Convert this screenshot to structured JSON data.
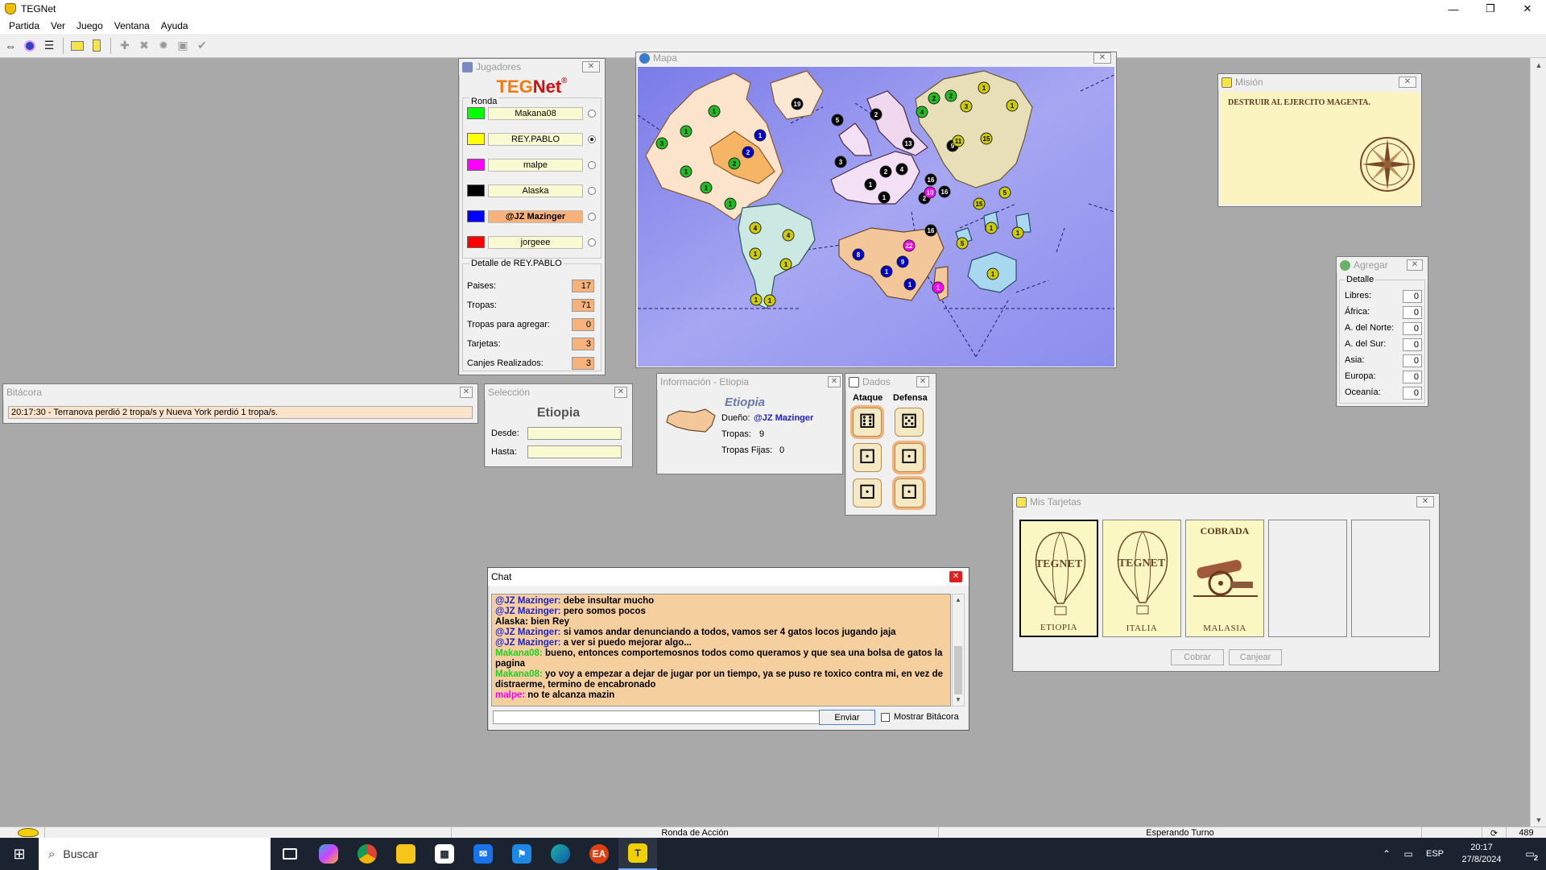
{
  "window": {
    "title": "TEGNet",
    "min": "—",
    "max": "❐",
    "close": "✕"
  },
  "menu": [
    "Partida",
    "Ver",
    "Juego",
    "Ventana",
    "Ayuda"
  ],
  "toolbar_icons": [
    "connect-icon",
    "server-icon",
    "list-icon",
    "card-yellow-icon",
    "card-icon",
    "add-army-icon",
    "delete-icon",
    "attack-icon",
    "regroup-icon",
    "check-icon"
  ],
  "jugadores": {
    "title": "Jugadores",
    "logo_teg": "TEG",
    "logo_net": "Net",
    "logo_reg": "®",
    "ronda_label": "Ronda",
    "players": [
      {
        "name": "Makana08",
        "color": "#00ff00",
        "current": false,
        "turn": false
      },
      {
        "name": "REY.PABLO",
        "color": "#ffff00",
        "current": false,
        "turn": true
      },
      {
        "name": "malpe",
        "color": "#ff00ff",
        "current": false,
        "turn": false
      },
      {
        "name": "Alaska",
        "color": "#000000",
        "current": false,
        "turn": false
      },
      {
        "name": "@JZ Mazinger",
        "color": "#0000ff",
        "current": true,
        "turn": false
      },
      {
        "name": "jorgeee",
        "color": "#ff0000",
        "current": false,
        "turn": false
      }
    ],
    "detalle_title": "Detalle de REY.PABLO",
    "detalle": [
      {
        "label": "Paises:",
        "value": "17"
      },
      {
        "label": "Tropas:",
        "value": "71"
      },
      {
        "label": "Tropas para agregar:",
        "value": "0"
      },
      {
        "label": "Tarjetas:",
        "value": "3"
      },
      {
        "label": "Canjes Realizados:",
        "value": "3"
      }
    ]
  },
  "mapa": {
    "title": "Mapa",
    "markers": [
      {
        "n": "1",
        "c": "#22bb22"
      },
      {
        "n": "1",
        "c": "#22bb22"
      },
      {
        "n": "3",
        "c": "#22bb22"
      },
      {
        "n": "1",
        "c": "#22bb22"
      },
      {
        "n": "1",
        "c": "#22bb22"
      },
      {
        "n": "1",
        "c": "#22bb22"
      },
      {
        "n": "2",
        "c": "#22bb22"
      },
      {
        "n": "1",
        "c": "#0000cc"
      },
      {
        "n": "2",
        "c": "#0000cc"
      },
      {
        "n": "19",
        "c": "#000000"
      },
      {
        "n": "5",
        "c": "#000000"
      },
      {
        "n": "3",
        "c": "#000000"
      },
      {
        "n": "2",
        "c": "#000000"
      },
      {
        "n": "1",
        "c": "#000000"
      },
      {
        "n": "1",
        "c": "#000000"
      },
      {
        "n": "2",
        "c": "#000000"
      },
      {
        "n": "4",
        "c": "#000000"
      },
      {
        "n": "13",
        "c": "#000000"
      },
      {
        "n": "2",
        "c": "#000000"
      },
      {
        "n": "16",
        "c": "#000000"
      },
      {
        "n": "16",
        "c": "#000000"
      },
      {
        "n": "16",
        "c": "#000000"
      },
      {
        "n": "10",
        "c": "#ff00ff"
      },
      {
        "n": "9",
        "c": "#000000"
      },
      {
        "n": "2",
        "c": "#22bb22"
      },
      {
        "n": "2",
        "c": "#22bb22"
      },
      {
        "n": "4",
        "c": "#22bb22"
      },
      {
        "n": "1",
        "c": "#cccc00"
      },
      {
        "n": "3",
        "c": "#cccc00"
      },
      {
        "n": "11",
        "c": "#cccc00"
      },
      {
        "n": "15",
        "c": "#cccc00"
      },
      {
        "n": "1",
        "c": "#cccc00"
      },
      {
        "n": "15",
        "c": "#cccc00"
      },
      {
        "n": "5",
        "c": "#cccc00"
      },
      {
        "n": "4",
        "c": "#cccc00"
      },
      {
        "n": "4",
        "c": "#cccc00"
      },
      {
        "n": "1",
        "c": "#cccc00"
      },
      {
        "n": "1",
        "c": "#cccc00"
      },
      {
        "n": "1",
        "c": "#cccc00"
      },
      {
        "n": "1",
        "c": "#cccc00"
      },
      {
        "n": "8",
        "c": "#0000cc"
      },
      {
        "n": "22",
        "c": "#ff00ff"
      },
      {
        "n": "9",
        "c": "#0000cc"
      },
      {
        "n": "1",
        "c": "#0000cc"
      },
      {
        "n": "1",
        "c": "#0000cc"
      },
      {
        "n": "1",
        "c": "#ff00ff"
      },
      {
        "n": "5",
        "c": "#cccc00"
      },
      {
        "n": "1",
        "c": "#cccc00"
      },
      {
        "n": "1",
        "c": "#cccc00"
      },
      {
        "n": "1",
        "c": "#cccc00"
      }
    ]
  },
  "mision": {
    "title": "Misión",
    "text": "DESTRUIR AL EJERCITO MAGENTA."
  },
  "agregar": {
    "title": "Agregar",
    "detalle_label": "Detalle",
    "rows": [
      {
        "label": "Libres:",
        "value": "0"
      },
      {
        "label": "África:",
        "value": "0"
      },
      {
        "label": "A. del Norte:",
        "value": "0"
      },
      {
        "label": "A. del Sur:",
        "value": "0"
      },
      {
        "label": "Asia:",
        "value": "0"
      },
      {
        "label": "Europa:",
        "value": "0"
      },
      {
        "label": "Oceanía:",
        "value": "0"
      }
    ]
  },
  "bitacora": {
    "title": "Bitácora",
    "entry": "20:17:30 - Terranova perdió 2 tropa/s y Nueva York perdió 1 tropa/s."
  },
  "seleccion": {
    "title": "Selección",
    "country": "Etiopia",
    "desde_label": "Desde:",
    "hasta_label": "Hasta:",
    "desde": "",
    "hasta": ""
  },
  "informacion": {
    "title": "Información - Etiopia",
    "country": "Etiopia",
    "dueno_label": "Dueño:",
    "dueno": "@JZ Mazinger",
    "tropas_label": "Tropas:",
    "tropas": "9",
    "fijas_label": "Tropas Fijas:",
    "fijas": "0"
  },
  "dados": {
    "title": "Dados",
    "ataque_label": "Ataque",
    "defensa_label": "Defensa",
    "ataque": [
      {
        "face": "⚅",
        "selected": true
      },
      {
        "face": "⚀",
        "selected": false
      },
      {
        "face": "⚀",
        "selected": false
      }
    ],
    "defensa": [
      {
        "face": "⚄",
        "selected": false
      },
      {
        "face": "⚀",
        "selected": true
      },
      {
        "face": "⚀",
        "selected": true
      }
    ]
  },
  "tarjetas": {
    "title": "Mis Tarjetas",
    "cards": [
      {
        "name": "ETIOPIA",
        "top": "",
        "kind": "balloon",
        "selected": true
      },
      {
        "name": "ITALIA",
        "top": "",
        "kind": "balloon",
        "selected": false
      },
      {
        "name": "MALASIA",
        "top": "COBRADA",
        "kind": "cannon",
        "selected": false
      }
    ],
    "logo_text": "TEGNET",
    "cobrar_label": "Cobrar",
    "canjear_label": "Canjear"
  },
  "chat": {
    "title": "Chat",
    "lines": [
      {
        "user": "@JZ Mazinger",
        "color": "#2222cc",
        "msg": "debe insultar mucho"
      },
      {
        "user": "@JZ Mazinger",
        "color": "#2222cc",
        "msg": "pero somos pocos"
      },
      {
        "user": "Alaska",
        "color": "#000000",
        "msg": "bien Rey"
      },
      {
        "user": "@JZ Mazinger",
        "color": "#2222cc",
        "msg": "si vamos andar denunciando a todos, vamos ser 4 gatos locos jugando jaja"
      },
      {
        "user": "@JZ Mazinger",
        "color": "#2222cc",
        "msg": "a ver si puedo mejorar algo..."
      },
      {
        "user": "Makana08",
        "color": "#22cc22",
        "msg": "bueno, entonces comportemosnos todos como queramos y que sea una bolsa de gatos la pagina"
      },
      {
        "user": "Makana08",
        "color": "#22cc22",
        "msg": "yo voy a empezar a dejar de jugar por un tiempo, ya se puso re toxico contra mi, en vez de distraerme, termino de encabronado"
      },
      {
        "user": "malpe",
        "color": "#ff00ff",
        "msg": "no te alcanza mazin"
      }
    ],
    "input_value": "",
    "send_label": "Enviar",
    "bitacora_label": "Mostrar Bitácora"
  },
  "statusbar": {
    "phase": "Ronda de Acción",
    "status": "Esperando Turno",
    "number": "489"
  },
  "taskbar": {
    "search_placeholder": "Buscar",
    "lang": "ESP",
    "time": "20:17",
    "date": "27/8/2024",
    "notif_count": "2"
  }
}
